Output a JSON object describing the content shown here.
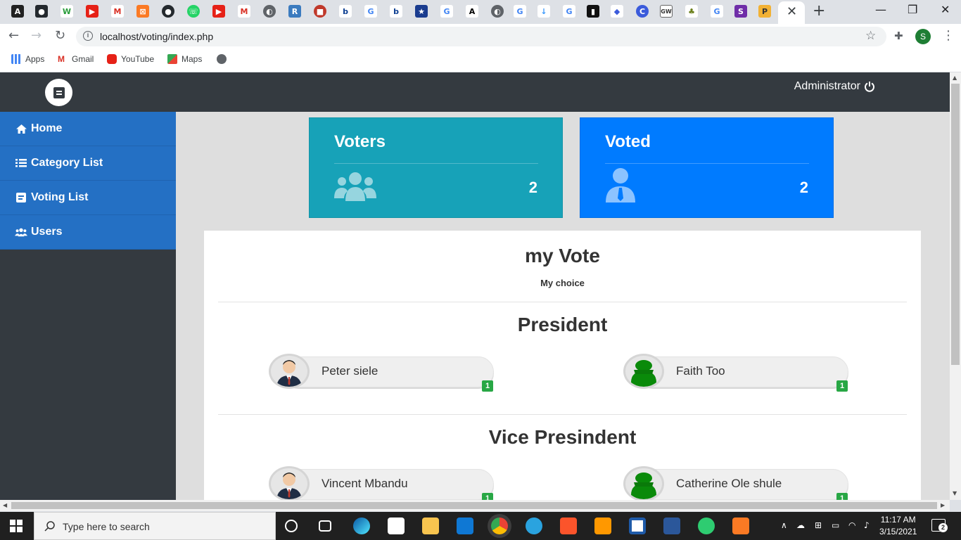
{
  "browser": {
    "url": "localhost/voting/index.php",
    "bookmarks": [
      "Apps",
      "Gmail",
      "YouTube",
      "Maps"
    ]
  },
  "app": {
    "user_label": "Administrator",
    "sidebar": {
      "items": [
        {
          "label": "Home",
          "icon": "home-icon"
        },
        {
          "label": "Category List",
          "icon": "list-icon"
        },
        {
          "label": "Voting List",
          "icon": "poll-icon"
        },
        {
          "label": "Users",
          "icon": "users-icon"
        }
      ]
    },
    "cards": {
      "voters": {
        "title": "Voters",
        "count": "2",
        "color": "#17a2b8"
      },
      "voted": {
        "title": "Voted",
        "count": "2",
        "color": "#007bff"
      }
    },
    "panel": {
      "title": "my Vote",
      "subtitle": "My choice",
      "categories": [
        {
          "title": "President",
          "candidates": [
            {
              "name": "Peter siele",
              "votes": "1",
              "avatar": "man-avatar-icon"
            },
            {
              "name": "Faith Too",
              "votes": "1",
              "avatar": "green-avatar-icon"
            }
          ]
        },
        {
          "title": "Vice Presindent",
          "candidates": [
            {
              "name": "Vincent Mbandu",
              "votes": "1",
              "avatar": "man-avatar-icon"
            },
            {
              "name": "Catherine Ole shule",
              "votes": "1",
              "avatar": "green-avatar-icon"
            }
          ]
        }
      ]
    }
  },
  "taskbar": {
    "search_placeholder": "Type here to search",
    "time": "11:17 AM",
    "date": "3/15/2021",
    "notifications": "2"
  }
}
